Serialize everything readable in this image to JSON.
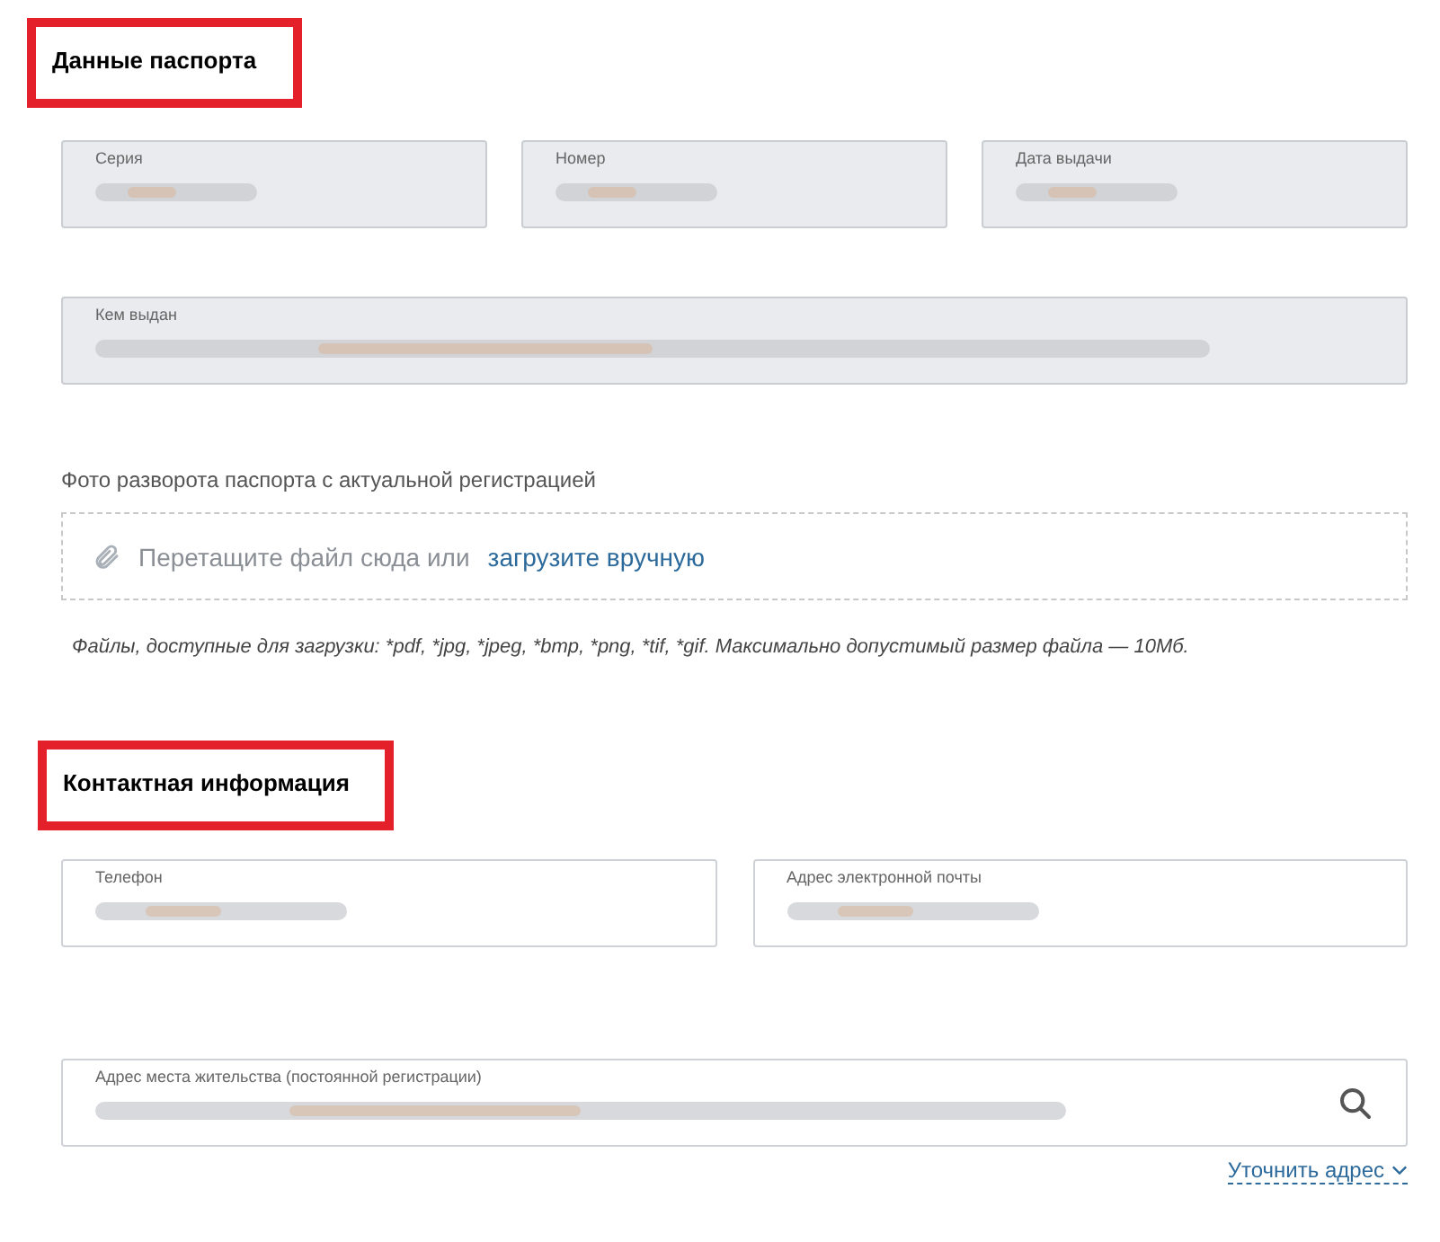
{
  "passport": {
    "title": "Данные паспорта",
    "fields": [
      {
        "label": "Серия",
        "redacted": true
      },
      {
        "label": "Номер",
        "redacted": true
      },
      {
        "label": "Дата выдачи",
        "redacted": true
      }
    ],
    "issued_by": {
      "label": "Кем выдан",
      "redacted": true
    },
    "upload": {
      "label": "Фото разворота паспорта с актуальной регистрацией",
      "drop_text": "Перетащите файл сюда или",
      "link": "загрузите вручную",
      "hint": "Файлы, доступные для загрузки: *pdf, *jpg, *jpeg, *bmp, *png, *tif, *gif. Максимально допустимый размер файла — 10Мб."
    }
  },
  "contact": {
    "title": "Контактная информация",
    "fields": [
      {
        "label": "Телефон",
        "redacted": true
      },
      {
        "label": "Адрес электронной почты",
        "redacted": true
      }
    ],
    "address": {
      "label": "Адрес места жительства (постоянной регистрации)",
      "redacted": true
    },
    "refine_link": "Уточнить адрес"
  }
}
